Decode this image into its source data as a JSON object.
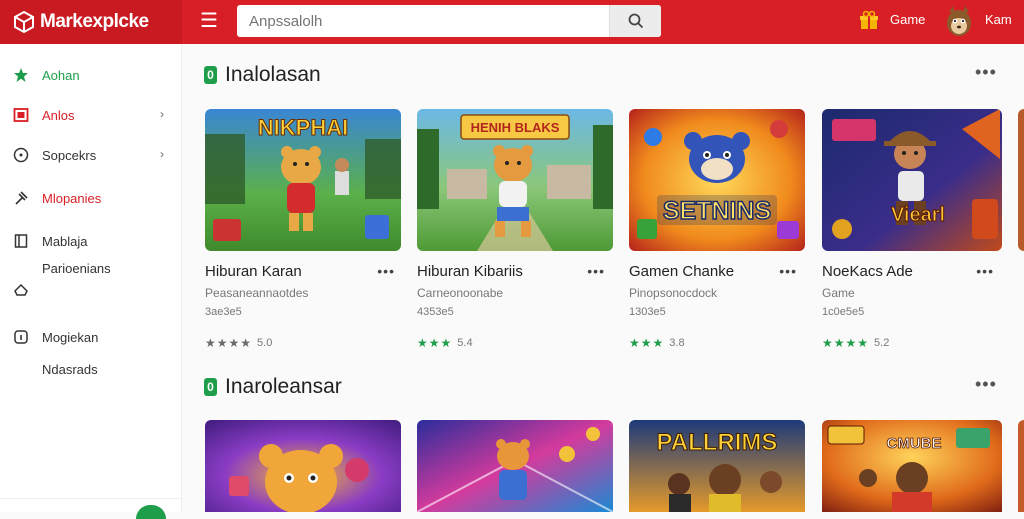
{
  "header": {
    "brand": "Markexplcke",
    "search_placeholder": "Anpssalolh",
    "game_link": "Game",
    "user_name": "Kam"
  },
  "sidebar": {
    "items": [
      {
        "label": "Aohan",
        "icon": "star-icon"
      },
      {
        "label": "Anlos",
        "icon": "box-icon"
      },
      {
        "label": "Sopcekrs",
        "icon": "compass-icon"
      },
      {
        "label": "Mlopanies",
        "icon": "pin-icon"
      },
      {
        "label": "Mablaja",
        "icon": "book-icon"
      },
      {
        "label": "Parioenians",
        "icon": "home-icon"
      },
      {
        "label": "Mogiekan",
        "icon": "info-icon"
      },
      {
        "label": "Ndasrads"
      }
    ]
  },
  "sections": [
    {
      "title": "Inalolasan",
      "cards": [
        {
          "art_text": "NIKPHAI",
          "title": "Hiburan Karan",
          "dev": "Peasaneannaotdes",
          "size": "3ae3e5",
          "rating": "5.0"
        },
        {
          "art_text": "HENIH BLAKS",
          "title": "Hiburan Kibariis",
          "dev": "Carneonoonabe",
          "size": "4353e5",
          "rating": "5.4"
        },
        {
          "art_text": "SETNINS",
          "title": "Gamen Chanke",
          "dev": "Pinopsonocdock",
          "size": "1303e5",
          "rating": "3.8"
        },
        {
          "art_text": "Viearl",
          "title": "NoeKacs Ade",
          "dev": "Game",
          "size": "1c0e5e5",
          "rating": "5.2"
        }
      ]
    },
    {
      "title": "Inaroleansar",
      "cards": [
        {
          "art_text": ""
        },
        {
          "art_text": ""
        },
        {
          "art_text": "PALLRIMS"
        },
        {
          "art_text": "CMUBE"
        }
      ]
    }
  ],
  "colors": {
    "brand_red": "#d81f26",
    "accent_green": "#1e9e4a"
  }
}
